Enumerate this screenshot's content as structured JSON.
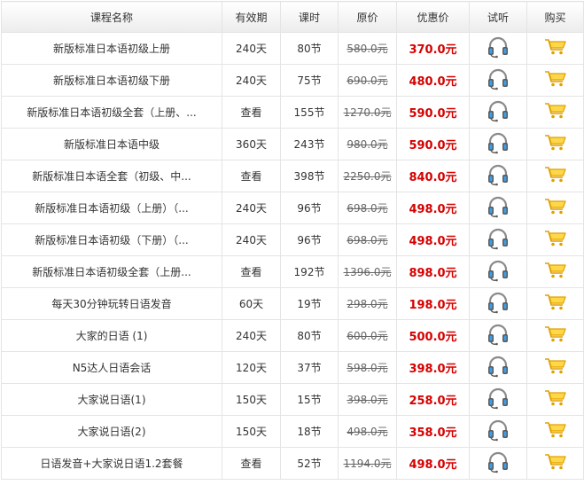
{
  "headers": {
    "name": "课程名称",
    "validity": "有效期",
    "hours": "课时",
    "original_price": "原价",
    "sale_price": "优惠价",
    "trial": "试听",
    "buy": "购买"
  },
  "icons": {
    "trial": "headphones-icon",
    "buy": "shopping-cart-icon"
  },
  "colors": {
    "name_link": "#1f5fa3",
    "sale_price": "#d60000",
    "cart": "#f2b400",
    "border": "#e4e4e4"
  },
  "rows": [
    {
      "name": "新版标准日本语初级上册",
      "validity": "240天",
      "hours": "80节",
      "original_price": "580.0元",
      "sale_price": "370.0元"
    },
    {
      "name": "新版标准日本语初级下册",
      "validity": "240天",
      "hours": "75节",
      "original_price": "690.0元",
      "sale_price": "480.0元"
    },
    {
      "name": "新版标准日本语初级全套（上册、...",
      "validity": "查看",
      "hours": "155节",
      "original_price": "1270.0元",
      "sale_price": "590.0元"
    },
    {
      "name": "新版标准日本语中级",
      "validity": "360天",
      "hours": "243节",
      "original_price": "980.0元",
      "sale_price": "590.0元"
    },
    {
      "name": "新版标准日本语全套（初级、中...",
      "validity": "查看",
      "hours": "398节",
      "original_price": "2250.0元",
      "sale_price": "840.0元"
    },
    {
      "name": "新版标准日本语初级（上册）（...",
      "validity": "240天",
      "hours": "96节",
      "original_price": "698.0元",
      "sale_price": "498.0元"
    },
    {
      "name": "新版标准日本语初级（下册）（...",
      "validity": "240天",
      "hours": "96节",
      "original_price": "698.0元",
      "sale_price": "498.0元"
    },
    {
      "name": "新版标准日本语初级全套（上册...",
      "validity": "查看",
      "hours": "192节",
      "original_price": "1396.0元",
      "sale_price": "898.0元"
    },
    {
      "name": "每天30分钟玩转日语发音",
      "validity": "60天",
      "hours": "19节",
      "original_price": "298.0元",
      "sale_price": "198.0元"
    },
    {
      "name": "大家的日语 (1)",
      "validity": "240天",
      "hours": "80节",
      "original_price": "600.0元",
      "sale_price": "500.0元"
    },
    {
      "name": "N5达人日语会话",
      "validity": "120天",
      "hours": "37节",
      "original_price": "598.0元",
      "sale_price": "398.0元"
    },
    {
      "name": "大家说日语(1)",
      "validity": "150天",
      "hours": "15节",
      "original_price": "398.0元",
      "sale_price": "258.0元"
    },
    {
      "name": "大家说日语(2)",
      "validity": "150天",
      "hours": "18节",
      "original_price": "498.0元",
      "sale_price": "358.0元"
    },
    {
      "name": "日语发音+大家说日语1.2套餐",
      "validity": "查看",
      "hours": "52节",
      "original_price": "1194.0元",
      "sale_price": "498.0元"
    }
  ]
}
